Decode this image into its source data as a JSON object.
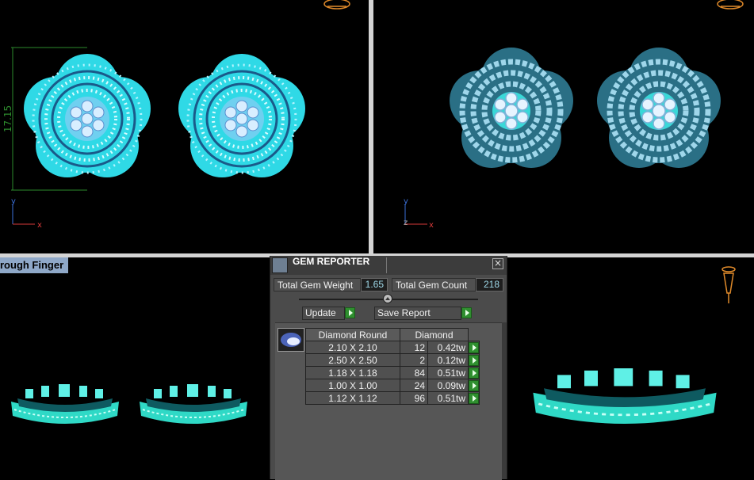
{
  "viewports": {
    "top_left": {
      "dimension_label": "17.15",
      "axis_y": "y",
      "axis_x": "x"
    },
    "top_right": {
      "axis_y": "y",
      "axis_x": "x",
      "axis_z": "z"
    },
    "bottom_left": {
      "label": "rough Finger"
    }
  },
  "gem_reporter": {
    "title": "GEM REPORTER",
    "close": "×",
    "total_weight_label": "Total Gem Weight",
    "total_weight_value": "1.65",
    "total_count_label": "Total Gem Count",
    "total_count_value": "218",
    "update_label": "Update",
    "save_label": "Save Report",
    "table": {
      "header_shape": "Diamond Round",
      "header_material": "Diamond",
      "rows": [
        {
          "size": "2.10 X 2.10",
          "count": "12",
          "weight": "0.42tw"
        },
        {
          "size": "2.50 X 2.50",
          "count": "2",
          "weight": "0.12tw"
        },
        {
          "size": "1.18 X 1.18",
          "count": "84",
          "weight": "0.51tw"
        },
        {
          "size": "1.00 X 1.00",
          "count": "24",
          "weight": "0.09tw"
        },
        {
          "size": "1.12 X 1.12",
          "count": "96",
          "weight": "0.51tw"
        }
      ]
    }
  },
  "colors": {
    "gem": "#35e0e0",
    "dimension": "#2d8a2d",
    "panel": "#4b4b4b"
  }
}
